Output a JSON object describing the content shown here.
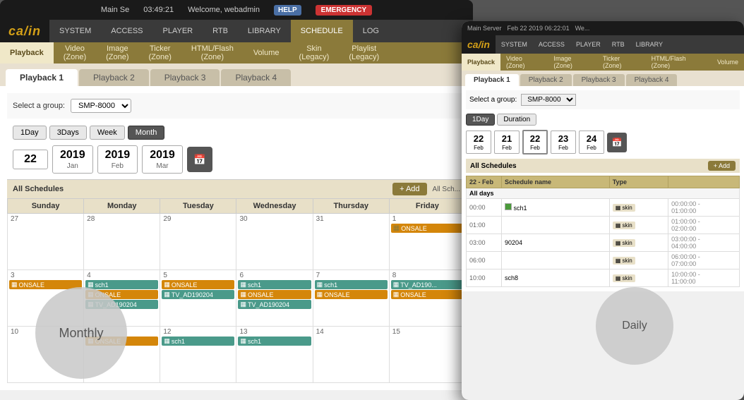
{
  "laptop": {
    "topbar": {
      "title": "Main Se",
      "time": "03:49:21",
      "welcome": "Welcome, webadmin",
      "help": "HELP",
      "emergency": "EMERGENCY"
    },
    "nav": {
      "items": [
        "SYSTEM",
        "ACCESS",
        "PLAYER",
        "RTB",
        "LIBRARY",
        "SCHEDULE",
        "LOG"
      ]
    },
    "subnav": {
      "items": [
        "Playback",
        "Video\n(Zone)",
        "Image\n(Zone)",
        "Ticker\n(Zone)",
        "HTML/Flash\n(Zone)",
        "Volume",
        "Skin\n(Legacy)",
        "Playlist\n(Legacy)"
      ]
    },
    "playback_tabs": [
      "Playback 1",
      "Playback 2",
      "Playback 3",
      "Playback 4"
    ],
    "group_label": "Select a group:",
    "group_value": "SMP-8000",
    "view_buttons": [
      "1Day",
      "3Days",
      "Week",
      "Month"
    ],
    "dates": [
      {
        "num": "22",
        "label": ""
      },
      {
        "num": "2019",
        "label": "Jan"
      },
      {
        "num": "2019",
        "label": "Feb"
      },
      {
        "num": "2019",
        "label": "Mar"
      }
    ],
    "schedule_label": "All Schedules",
    "add_label": "+ Add",
    "all_sch_label": "All Sch...",
    "calendar": {
      "headers": [
        "Sunday",
        "Monday",
        "Tuesday",
        "Wednesday",
        "Thursday",
        "Friday"
      ],
      "rows": [
        {
          "days": [
            {
              "num": "27",
              "events": []
            },
            {
              "num": "28",
              "events": []
            },
            {
              "num": "29",
              "events": []
            },
            {
              "num": "30",
              "events": []
            },
            {
              "num": "31",
              "events": []
            },
            {
              "num": "1",
              "events": [
                {
                  "label": "ONSALE",
                  "type": "orange"
                }
              ]
            }
          ]
        },
        {
          "days": [
            {
              "num": "3",
              "events": [
                {
                  "label": "ONSALE",
                  "type": "orange"
                }
              ]
            },
            {
              "num": "4",
              "events": [
                {
                  "label": "sch1",
                  "type": "teal"
                },
                {
                  "label": "ONSALE",
                  "type": "orange"
                },
                {
                  "label": "TV_AD190204",
                  "type": "teal"
                }
              ]
            },
            {
              "num": "5",
              "events": [
                {
                  "label": "ONSALE",
                  "type": "orange"
                },
                {
                  "label": "TV_AD190204",
                  "type": "teal"
                }
              ]
            },
            {
              "num": "6",
              "events": [
                {
                  "label": "sch1",
                  "type": "teal"
                },
                {
                  "label": "ONSALE",
                  "type": "orange"
                },
                {
                  "label": "TV_AD190204",
                  "type": "teal"
                }
              ]
            },
            {
              "num": "7",
              "events": [
                {
                  "label": "sch1",
                  "type": "teal"
                },
                {
                  "label": "ONSALE",
                  "type": "orange"
                }
              ]
            },
            {
              "num": "8",
              "events": [
                {
                  "label": "TV_AD190...",
                  "type": "teal"
                },
                {
                  "label": "ONSALE",
                  "type": "orange"
                }
              ]
            }
          ]
        },
        {
          "days": [
            {
              "num": "10",
              "events": []
            },
            {
              "num": "11",
              "events": [
                {
                  "label": "ONSALE",
                  "type": "orange"
                }
              ]
            },
            {
              "num": "12",
              "events": [
                {
                  "label": "sch1",
                  "type": "teal"
                }
              ]
            },
            {
              "num": "13",
              "events": [
                {
                  "label": "sch1",
                  "type": "teal"
                }
              ]
            },
            {
              "num": "14",
              "events": []
            },
            {
              "num": "15",
              "events": []
            }
          ]
        }
      ]
    }
  },
  "overlay": {
    "monthly_label": "Monthly",
    "daily_label": "Daily"
  },
  "tablet": {
    "topbar": {
      "title": "Main Server",
      "date": "Feb 22 2019 06:22:01",
      "welcome": "We..."
    },
    "nav": {
      "items": [
        "SYSTEM",
        "ACCESS",
        "PLAYER",
        "RTB",
        "LIBRARY"
      ]
    },
    "subnav": {
      "items": [
        "Playback",
        "Video\n(Zone)",
        "Image\n(Zone)",
        "Ticker\n(Zone)",
        "HTML/Flash\n(Zone)",
        "Volume"
      ]
    },
    "playback_tabs": [
      "Playback 1",
      "Playback 2",
      "Playback 3",
      "Playback 4"
    ],
    "group_label": "Select a group:",
    "group_value": "SMP-8000",
    "view_buttons": [
      "1Day",
      "Duration"
    ],
    "dates": [
      {
        "num": "22",
        "label": "Feb"
      },
      {
        "num": "21",
        "label": "Feb"
      },
      {
        "num": "22",
        "label": "Feb"
      },
      {
        "num": "23",
        "label": "Feb"
      },
      {
        "num": "24",
        "label": "Feb"
      }
    ],
    "schedule_label": "All Schedules",
    "add_label": "+ Add",
    "date_header": "22 - Feb",
    "table_headers": [
      "Schedule name",
      "Type",
      ""
    ],
    "all_days_label": "All days",
    "time_00": "00:00",
    "time_01": "01:00",
    "time_03": "03:00",
    "time_06": "06:00",
    "time_10": "10:00",
    "schedule_rows": [
      {
        "time": "00:00",
        "name": "sch1",
        "type": "skin",
        "range": "00:00:00 - 01:00:00"
      },
      {
        "time": "01:00",
        "name": "",
        "type": "skin",
        "range": "01:00:00 - 02:00:00"
      },
      {
        "time": "03:00",
        "name": "90204",
        "type": "skin",
        "range": "03:00:00 - 04:00:00"
      },
      {
        "time": "06:00",
        "name": "",
        "type": "skin",
        "range": "06:00:00 - 07:00:00"
      },
      {
        "time": "10:00",
        "name": "sch8",
        "type": "skin",
        "range": "10:00:00 - 11:00:00"
      }
    ]
  }
}
